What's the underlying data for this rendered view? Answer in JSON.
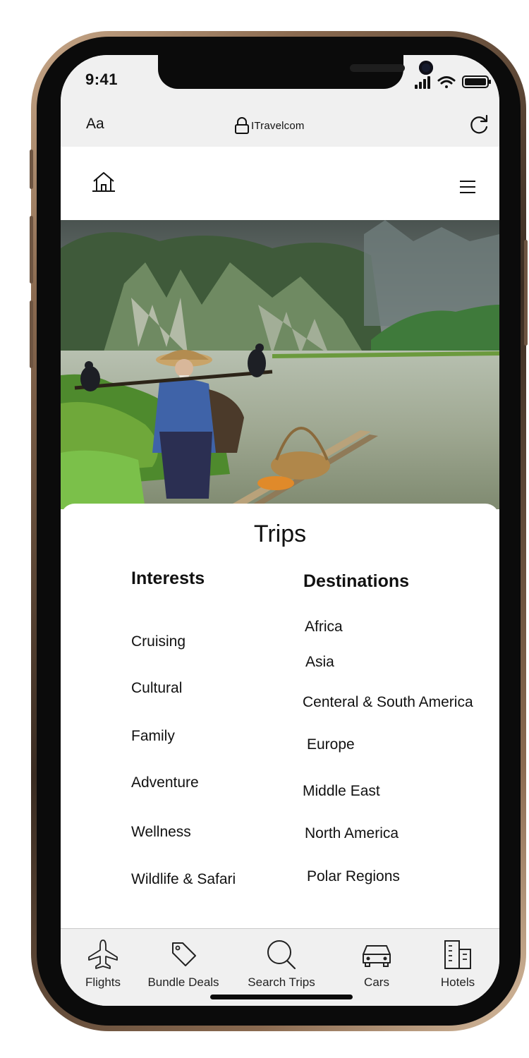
{
  "status_bar": {
    "time": "9:41"
  },
  "browser_bar": {
    "text_size_label": "Aa",
    "url": "ITravelcom",
    "icons": {
      "lock": "lock-icon",
      "reload": "reload-icon"
    }
  },
  "nav": {
    "home_icon": "home-icon",
    "menu_icon": "hamburger-menu-icon"
  },
  "hero": {
    "image": "river-fisherman-photo"
  },
  "trips": {
    "title": "Trips",
    "interests": {
      "heading": "Interests",
      "items": [
        "Cruising",
        "Cultural",
        "Family",
        "Adventure",
        "Wellness",
        "Wildlife & Safari"
      ]
    },
    "destinations": {
      "heading": "Destinations",
      "items": [
        "Africa",
        "Asia",
        "Centeral & South America",
        "Europe",
        "Middle East",
        "North America",
        "Polar Regions"
      ]
    }
  },
  "tab_bar": {
    "tabs": [
      {
        "label": "Flights",
        "icon": "airplane-icon"
      },
      {
        "label": "Bundle Deals",
        "icon": "tag-icon"
      },
      {
        "label": "Search Trips",
        "icon": "search-icon"
      },
      {
        "label": "Cars",
        "icon": "car-icon"
      },
      {
        "label": "Hotels",
        "icon": "hotel-building-icon"
      }
    ]
  },
  "colors": {
    "bar_gray": "#f0f0f0",
    "frame_gold": "#c9a98a",
    "text": "#111111"
  }
}
